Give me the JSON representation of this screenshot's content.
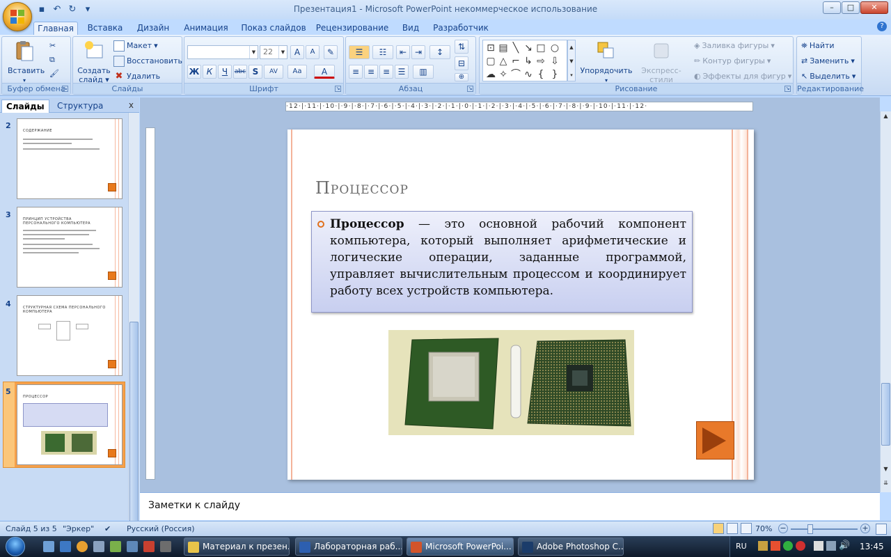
{
  "window": {
    "title": "Презентация1 - Microsoft PowerPoint некоммерческое использование"
  },
  "ribbon_tabs": [
    "Главная",
    "Вставка",
    "Дизайн",
    "Анимация",
    "Показ слайдов",
    "Рецензирование",
    "Вид",
    "Разработчик"
  ],
  "ribbon": {
    "clipboard": {
      "label": "Буфер обмена",
      "paste": "Вставить"
    },
    "slides": {
      "label": "Слайды",
      "new_slide_l1": "Создать",
      "new_slide_l2": "слайд",
      "layout": "Макет",
      "reset": "Восстановить",
      "delete": "Удалить"
    },
    "font": {
      "label": "Шрифт",
      "font_name": "",
      "font_size": "22"
    },
    "paragraph": {
      "label": "Абзац"
    },
    "drawing": {
      "label": "Рисование",
      "arrange": "Упорядочить",
      "quick_styles": "Экспресс-стили",
      "fill": "Заливка фигуры",
      "outline": "Контур фигуры",
      "effects": "Эффекты для фигур"
    },
    "editing": {
      "label": "Редактирование",
      "find": "Найти",
      "replace": "Заменить",
      "select": "Выделить"
    }
  },
  "panel": {
    "tab_slides": "Слайды",
    "tab_outline": "Структура",
    "close": "x",
    "thumbnails": [
      {
        "num": "2",
        "title": "СОДЕРЖАНИЕ"
      },
      {
        "num": "3",
        "title": "ПРИНЦИП УСТРОЙСТВА ПЕРСОНАЛЬНОГО КОМПЬЮТЕРА"
      },
      {
        "num": "4",
        "title": "СТРУКТУРНАЯ СХЕМА ПЕРСОНАЛЬНОГО КОМПЬЮТЕРА"
      },
      {
        "num": "5",
        "title": "ПРОЦЕССОР"
      }
    ]
  },
  "ruler": {
    "horizontal": "·12·|·11·|·10·|·9·|·8·|·7·|·6·|·5·|·4·|·3·|·2·|·1·|·0·|·1·|·2·|·3·|·4·|·5·|·6·|·7·|·8·|·9·|·10·|·11·|·12·"
  },
  "slide": {
    "title": "Процессор",
    "body_bold": "Процессор",
    "body_rest": " — это основной рабочий компонент компьютера, который выполняет арифметические и логические операции, заданные программой, управляет вычислительным процессом и координирует работу всех устройств компьютера."
  },
  "notes": {
    "placeholder": "Заметки к слайду"
  },
  "status": {
    "slide_pos": "Слайд 5 из 5",
    "theme": "\"Эркер\"",
    "language": "Русский (Россия)",
    "zoom": "70%"
  },
  "taskbar": {
    "buttons": [
      "Материал к презен...",
      "Лабораторная раб...",
      "Microsoft PowerPoi...",
      "Adobe Photoshop C..."
    ],
    "lang": "RU",
    "time": "13:45"
  },
  "colors": {
    "accent_orange": "#e8792a",
    "ribbon_blue": "#bfdbff",
    "text_blue": "#15428b"
  }
}
